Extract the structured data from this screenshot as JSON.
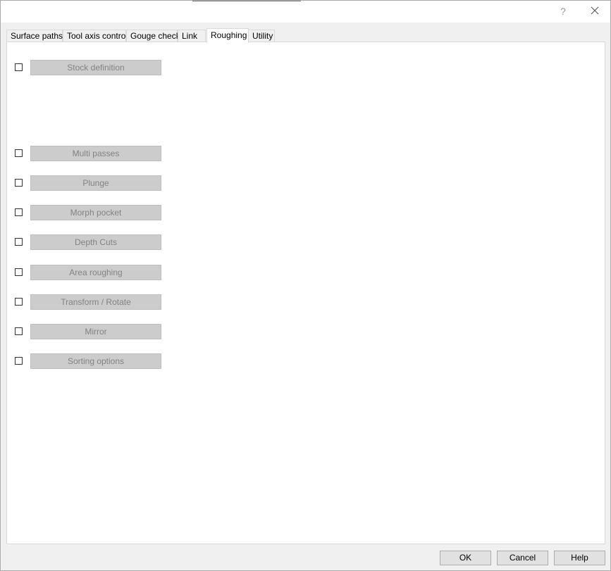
{
  "titlebar": {
    "help_label": "?",
    "close_icon": "close-icon"
  },
  "tabs": [
    {
      "label": "Surface paths"
    },
    {
      "label": "Tool axis control"
    },
    {
      "label": "Gouge check"
    },
    {
      "label": "Link"
    },
    {
      "label": "Roughing",
      "active": true
    },
    {
      "label": "Utility"
    }
  ],
  "options": [
    {
      "label": "Stock definition",
      "checked": false
    },
    {
      "label": "Multi passes",
      "checked": false
    },
    {
      "label": "Plunge",
      "checked": false
    },
    {
      "label": "Morph pocket",
      "checked": false
    },
    {
      "label": "Depth Cuts",
      "checked": false
    },
    {
      "label": "Area roughing",
      "checked": false
    },
    {
      "label": "Transform / Rotate",
      "checked": false
    },
    {
      "label": "Mirror",
      "checked": false
    },
    {
      "label": "Sorting options",
      "checked": false
    }
  ],
  "footer": {
    "ok_label": "OK",
    "cancel_label": "Cancel",
    "help_label": "Help"
  }
}
